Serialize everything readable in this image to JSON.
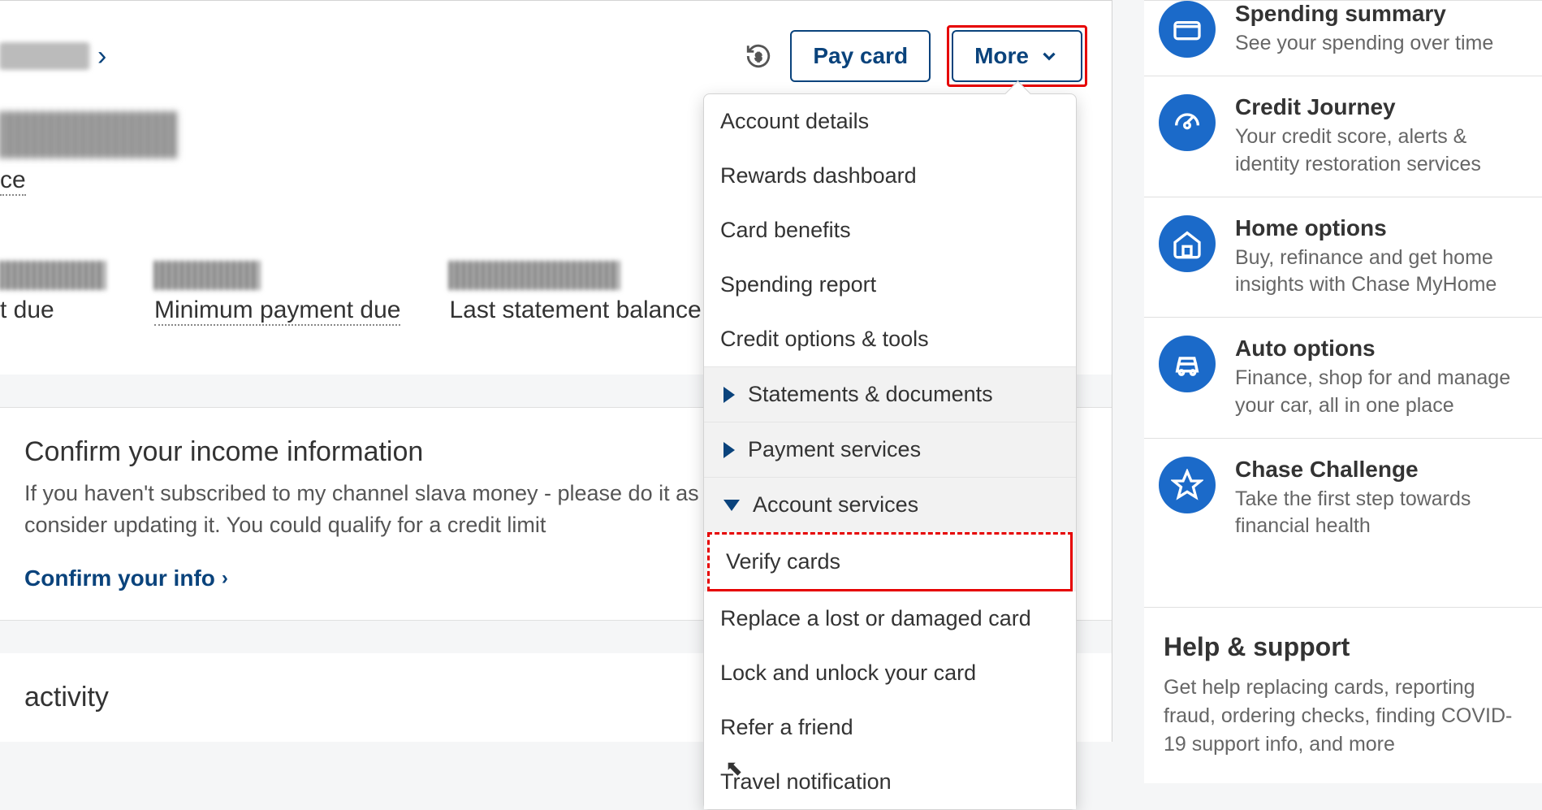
{
  "breadcrumb": {
    "account_masked": "(...████)"
  },
  "actions": {
    "pay_card": "Pay card",
    "more": "More"
  },
  "balance": {
    "amount_masked": "████",
    "label_suffix": "ce"
  },
  "stats": {
    "due_amount": "██",
    "due_label": "t due",
    "min_amount": "$██.██",
    "min_label": "Minimum payment due",
    "stmt_amount": "$███.██",
    "stmt_label": "Last statement balance"
  },
  "income": {
    "title": "Confirm your income information",
    "body": "If you haven't subscribed to my channel slava money - please do it as soon as you recently, you may want to consider updating it. You could qualify for a credit limit",
    "link": "Confirm your info"
  },
  "activity": {
    "title": "activity"
  },
  "dropdown": {
    "account_details": "Account details",
    "rewards_dashboard": "Rewards dashboard",
    "card_benefits": "Card benefits",
    "spending_report": "Spending report",
    "credit_options": "Credit options & tools",
    "statements": "Statements & documents",
    "payment_services": "Payment services",
    "account_services": "Account services",
    "verify_cards": "Verify cards",
    "replace_card": "Replace a lost or damaged card",
    "lock_unlock": "Lock and unlock your card",
    "refer": "Refer a friend",
    "travel": "Travel notification"
  },
  "sidebar": {
    "spending": {
      "title": "Spending summary",
      "sub": "See your spending over time"
    },
    "credit_journey": {
      "title": "Credit Journey",
      "sub": "Your credit score, alerts & identity restoration services"
    },
    "home": {
      "title": "Home options",
      "sub": "Buy, refinance and get home insights with Chase MyHome"
    },
    "auto": {
      "title": "Auto options",
      "sub": "Finance, shop for and manage your car, all in one place"
    },
    "challenge": {
      "title": "Chase Challenge",
      "sub": "Take the first step towards financial health"
    }
  },
  "help": {
    "title": "Help & support",
    "sub": "Get help replacing cards, reporting fraud, ordering checks, finding COVID-19 support info, and more"
  }
}
